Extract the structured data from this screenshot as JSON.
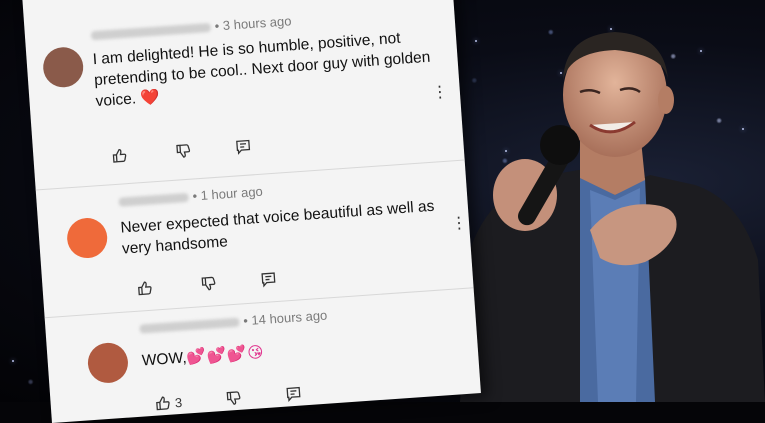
{
  "comments": [
    {
      "time": "3 hours ago",
      "lines": [
        "I am delighted! He is so humble, positive, not",
        "pretending to be cool.. Next door guy with golden",
        "voice."
      ],
      "emoji": "❤️",
      "likes": "",
      "avatar_color": "#8a5a4a"
    },
    {
      "time": "1 hour ago",
      "lines": [
        "Never expected that voice beautiful as well as",
        "very handsome"
      ],
      "emoji": "",
      "likes": "",
      "avatar_color": "#ef6a3a"
    },
    {
      "time": "14 hours ago",
      "lines": [
        "WOW,"
      ],
      "emoji": "💕💕💕😘",
      "likes": "3",
      "avatar_color": "#b05a40"
    }
  ],
  "icons": {
    "like": "thumbs-up-icon",
    "dislike": "thumbs-down-icon",
    "reply": "reply-icon",
    "more": "more-vertical-icon"
  }
}
